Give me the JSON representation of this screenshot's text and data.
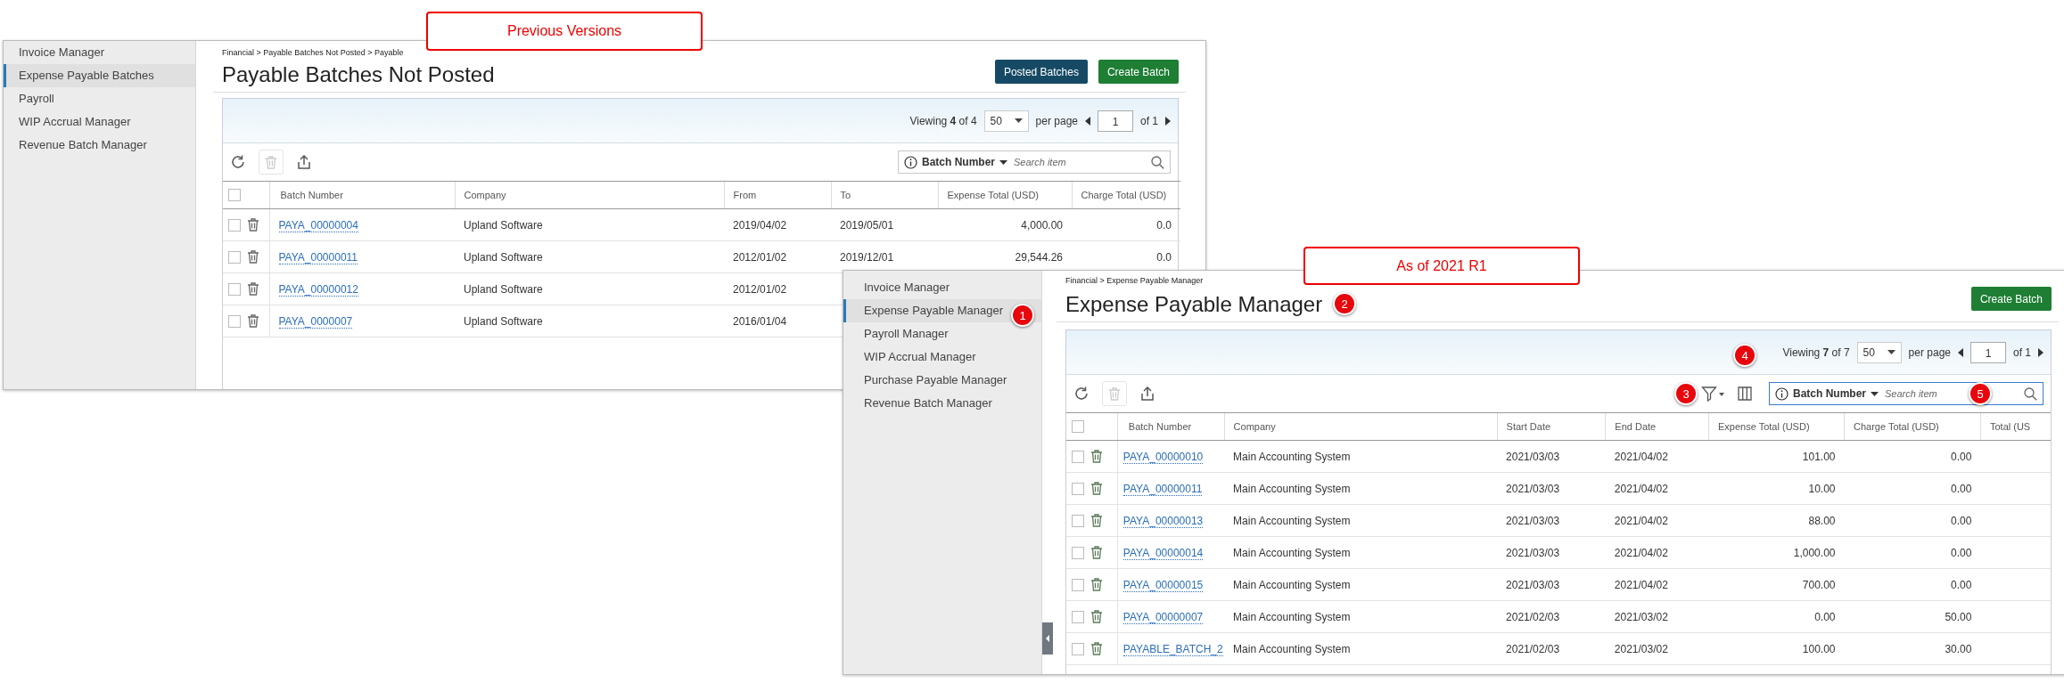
{
  "windows": [
    {
      "sidebar": {
        "items": [
          {
            "label": "Invoice Manager",
            "selected": false
          },
          {
            "label": "Expense Payable Batches",
            "selected": true
          },
          {
            "label": "Payroll",
            "selected": false
          },
          {
            "label": "WIP Accrual Manager",
            "selected": false
          },
          {
            "label": "Revenue Batch Manager",
            "selected": false
          }
        ]
      },
      "breadcrumb": "Financial > Payable Batches Not Posted > Payable",
      "title": "Payable Batches Not Posted",
      "buttons": [
        {
          "label": "Posted Batches",
          "kind": "secondary"
        },
        {
          "label": "Create Batch",
          "kind": "primary"
        }
      ],
      "pager": {
        "viewing": "Viewing **4** of 4",
        "per_page_value": "50",
        "per_page_label": "per page",
        "page": "1",
        "of": "of 1"
      },
      "tools": [
        {
          "kind": "refresh"
        },
        {
          "kind": "delete",
          "disabled": true
        },
        {
          "kind": "export"
        }
      ],
      "search": {
        "field": "Batch Number",
        "placeholder": "Search item",
        "focused": false
      },
      "table": {
        "all_checked": false,
        "columns": [
          {
            "label": "Batch Number",
            "kind": "link"
          },
          {
            "label": "Company",
            "kind": "text"
          },
          {
            "label": "From",
            "kind": "text"
          },
          {
            "label": "To",
            "kind": "text"
          },
          {
            "label": "Expense Total (USD)",
            "kind": "amount"
          },
          {
            "label": "Charge Total (USD)",
            "kind": "amount"
          }
        ],
        "rows": [
          {
            "checked": false,
            "cells": [
              "PAYA_00000004",
              "Upland Software",
              "2019/04/02",
              "2019/05/01",
              "4,000.00",
              "0.0"
            ]
          },
          {
            "checked": false,
            "cells": [
              "PAYA_00000011",
              "Upland Software",
              "2012/01/02",
              "2019/12/01",
              "29,544.26",
              "0.0"
            ]
          },
          {
            "checked": false,
            "cells": [
              "PAYA_00000012",
              "Upland Software",
              "2012/01/02"
            ]
          },
          {
            "checked": false,
            "cells": [
              "PAYA_0000007",
              "Upland Software",
              "2016/01/04"
            ]
          }
        ]
      }
    },
    {
      "sidebar": {
        "items": [
          {
            "label": "Invoice Manager",
            "selected": false
          },
          {
            "label": "Expense Payable Manager",
            "selected": true,
            "callout": "1"
          },
          {
            "label": "Payroll Manager",
            "selected": false
          },
          {
            "label": "WIP Accrual Manager",
            "selected": false
          },
          {
            "label": "Purchase Payable Manager",
            "selected": false
          },
          {
            "label": "Revenue Batch Manager",
            "selected": false
          }
        ]
      },
      "breadcrumb": "Financial > Expense Payable Manager",
      "title": "Expense Payable Manager",
      "title_callout": "2",
      "buttons": [
        {
          "label": "Create Batch",
          "kind": "primary"
        }
      ],
      "pager": {
        "viewing": "Viewing **7** of 7",
        "per_page_value": "50",
        "per_page_label": "per page",
        "page": "1",
        "of": "of 1"
      },
      "tools": [
        {
          "kind": "refresh"
        },
        {
          "kind": "delete",
          "disabled": true
        },
        {
          "kind": "export"
        }
      ],
      "view_tools": [
        {
          "kind": "filter",
          "callout": "3"
        },
        {
          "kind": "columns",
          "callout": "4"
        }
      ],
      "search": {
        "field": "Batch Number",
        "placeholder": "Search item",
        "focused": true,
        "callout": "5"
      },
      "table": {
        "all_checked": false,
        "columns": [
          {
            "label": "Batch Number",
            "kind": "link"
          },
          {
            "label": "Company",
            "kind": "text"
          },
          {
            "label": "Start Date",
            "kind": "text"
          },
          {
            "label": "End Date",
            "kind": "text"
          },
          {
            "label": "Expense Total (USD)",
            "kind": "amount"
          },
          {
            "label": "Charge Total (USD)",
            "kind": "amount"
          },
          {
            "label": "Total (US",
            "kind": "amount"
          }
        ],
        "rows": [
          {
            "checked": false,
            "cells": [
              "PAYA_00000010",
              "Main Accounting System",
              "2021/03/03",
              "2021/04/02",
              "101.00",
              "0.00"
            ]
          },
          {
            "checked": false,
            "cells": [
              "PAYA_00000011",
              "Main Accounting System",
              "2021/03/03",
              "2021/04/02",
              "10.00",
              "0.00"
            ]
          },
          {
            "checked": false,
            "cells": [
              "PAYA_00000013",
              "Main Accounting System",
              "2021/03/03",
              "2021/04/02",
              "88.00",
              "0.00"
            ]
          },
          {
            "checked": false,
            "cells": [
              "PAYA_00000014",
              "Main Accounting System",
              "2021/03/03",
              "2021/04/02",
              "1,000.00",
              "0.00"
            ]
          },
          {
            "checked": false,
            "cells": [
              "PAYA_00000015",
              "Main Accounting System",
              "2021/03/03",
              "2021/04/02",
              "700.00",
              "0.00"
            ]
          },
          {
            "checked": false,
            "cells": [
              "PAYA_00000007",
              "Main Accounting System",
              "2021/02/03",
              "2021/03/02",
              "0.00",
              "50.00"
            ]
          },
          {
            "checked": false,
            "cells": [
              "PAYABLE_BATCH_2",
              "Main Accounting System",
              "2021/02/03",
              "2021/03/02",
              "100.00",
              "30.00"
            ]
          }
        ]
      },
      "collapse_handle": true
    }
  ],
  "notes": [
    {
      "text": "Previous Versions"
    },
    {
      "text": "As of 2021 R1"
    }
  ]
}
